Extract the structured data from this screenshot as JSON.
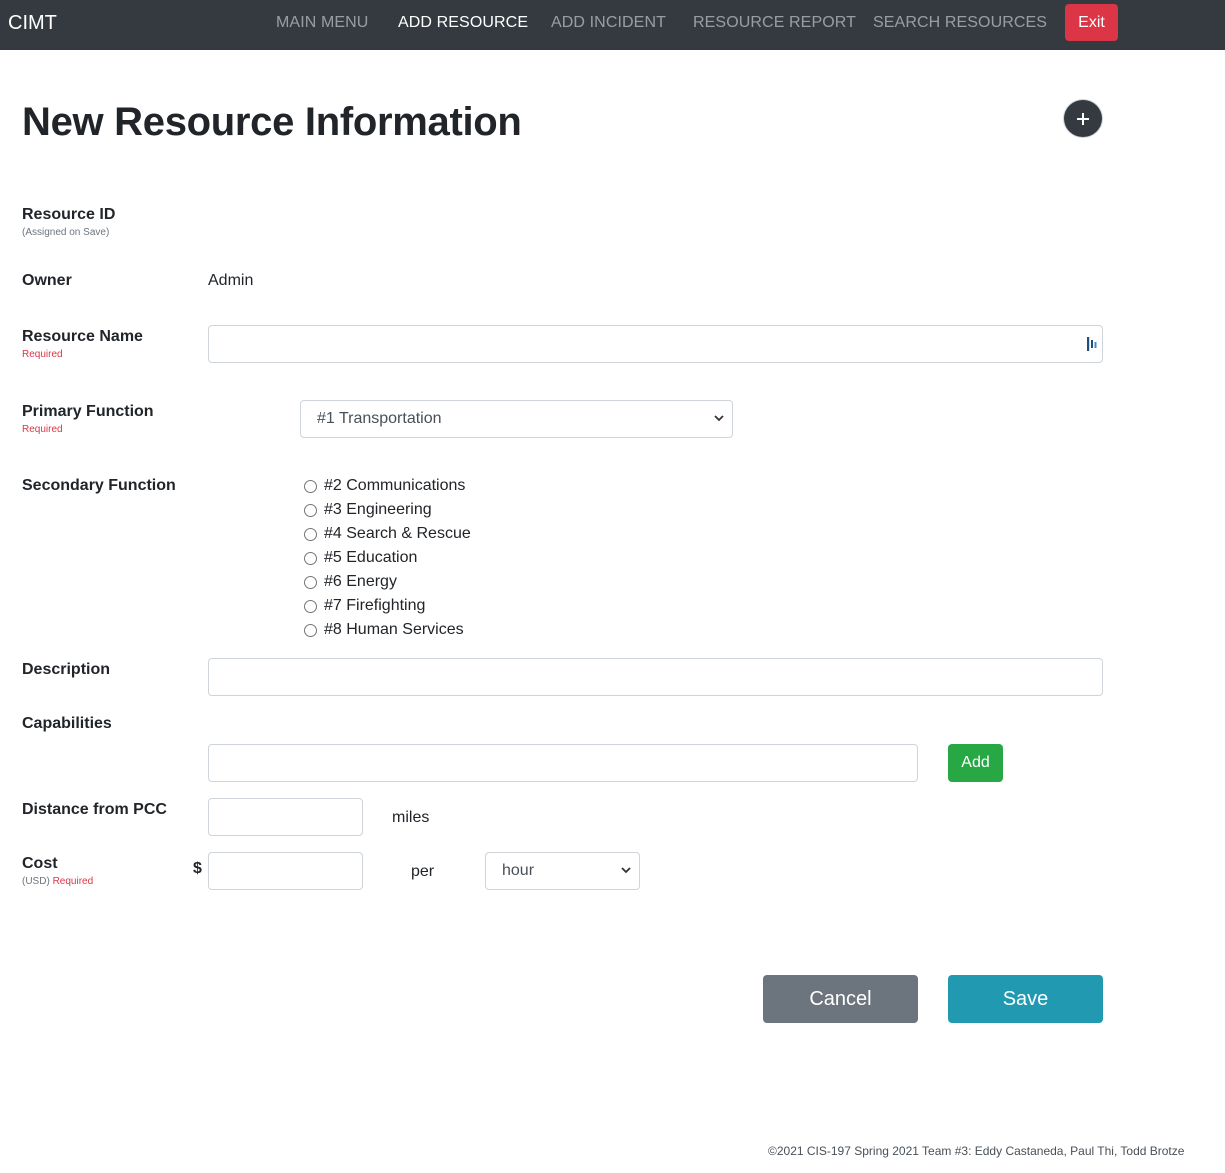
{
  "navbar": {
    "brand": "CIMT",
    "items": [
      {
        "label": "MAIN MENU"
      },
      {
        "label": "ADD RESOURCE"
      },
      {
        "label": "ADD INCIDENT"
      },
      {
        "label": "RESOURCE REPORT"
      },
      {
        "label": "SEARCH RESOURCES"
      }
    ],
    "active_item": "ADD RESOURCE",
    "exit_label": "Exit"
  },
  "page": {
    "title": "New Resource Information"
  },
  "form": {
    "resource_id": {
      "label": "Resource ID",
      "hint": "(Assigned on Save)"
    },
    "owner": {
      "label": "Owner",
      "value": "Admin"
    },
    "resource_name": {
      "label": "Resource Name",
      "required": "Required",
      "value": ""
    },
    "primary_function": {
      "label": "Primary Function",
      "required": "Required",
      "selected": "#1 Transportation"
    },
    "secondary_function": {
      "label": "Secondary Function",
      "options": [
        "#2 Communications",
        "#3 Engineering",
        "#4 Search & Rescue",
        "#5 Education",
        "#6 Energy",
        "#7 Firefighting",
        "#8 Human Services"
      ]
    },
    "description": {
      "label": "Description",
      "value": ""
    },
    "capabilities": {
      "label": "Capabilities",
      "value": "",
      "add_label": "Add"
    },
    "distance": {
      "label": "Distance from PCC",
      "value": "",
      "unit": "miles"
    },
    "cost": {
      "label": "Cost",
      "unit_hint": "(USD)",
      "required": "Required",
      "currency_symbol": "$",
      "value": "",
      "per_label": "per",
      "period_selected": "hour"
    }
  },
  "actions": {
    "cancel_label": "Cancel",
    "save_label": "Save"
  },
  "footer": {
    "text": "©2021 CIS-197 Spring 2021 Team #3: Eddy Castaneda, Paul Thi, Todd Brotze"
  },
  "colors": {
    "navbar_bg": "#343a40",
    "exit": "#dc3545",
    "add": "#28a745",
    "cancel": "#6c757d",
    "save": "#2199b1",
    "required": "#dc3545"
  }
}
